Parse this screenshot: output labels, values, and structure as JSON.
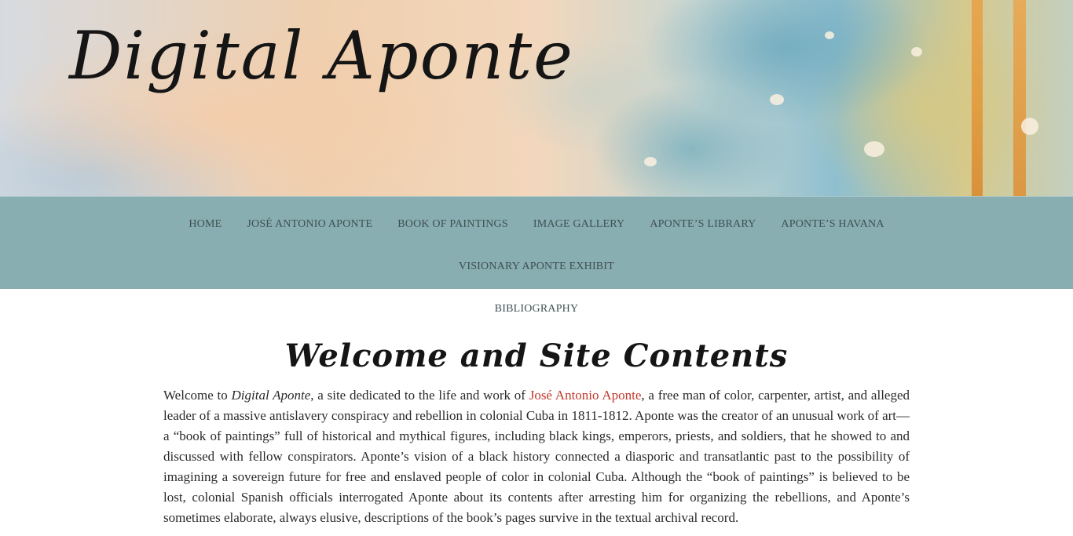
{
  "header": {
    "site_title": "Digital Aponte"
  },
  "nav": {
    "items": [
      {
        "label": "HOME"
      },
      {
        "label": "JOSÉ ANTONIO APONTE"
      },
      {
        "label": "BOOK OF PAINTINGS"
      },
      {
        "label": "IMAGE GALLERY"
      },
      {
        "label": "APONTE’S LIBRARY"
      },
      {
        "label": "APONTE’S HAVANA"
      },
      {
        "label": "VISIONARY APONTE EXHIBIT"
      },
      {
        "label": "BIBLIOGRAPHY"
      }
    ]
  },
  "main": {
    "title": "Welcome and Site Contents",
    "intro": {
      "p1": "Welcome to ",
      "em": "Digital Aponte",
      "p2": ", a site dedicated to the life and work of ",
      "link": "José Antonio Aponte",
      "p3": ", a free man of color, carpenter, artist, and alleged leader of a massive antislavery conspiracy and rebellion in colonial Cuba in 1811-1812. Aponte was the creator of an unusual work of art—a “book of paintings” full of historical and mythical figures, including black kings, emperors, priests, and soldiers, that he showed to and discussed with fellow conspirators. Aponte’s vision of a black history connected a diasporic and transatlantic past to the possibility of imagining a sovereign future for free and enslaved people of color in colonial Cuba. Although the “book of paintings” is believed to be lost, colonial Spanish officials interrogated Aponte about its contents after arresting him for organizing the rebellions, and Aponte’s sometimes elaborate, always elusive, descriptions of the book’s pages survive in the textual archival record."
    }
  },
  "colors": {
    "nav_background": "#88aeb1",
    "link": "#c0392b",
    "text": "#2a2a2a"
  }
}
